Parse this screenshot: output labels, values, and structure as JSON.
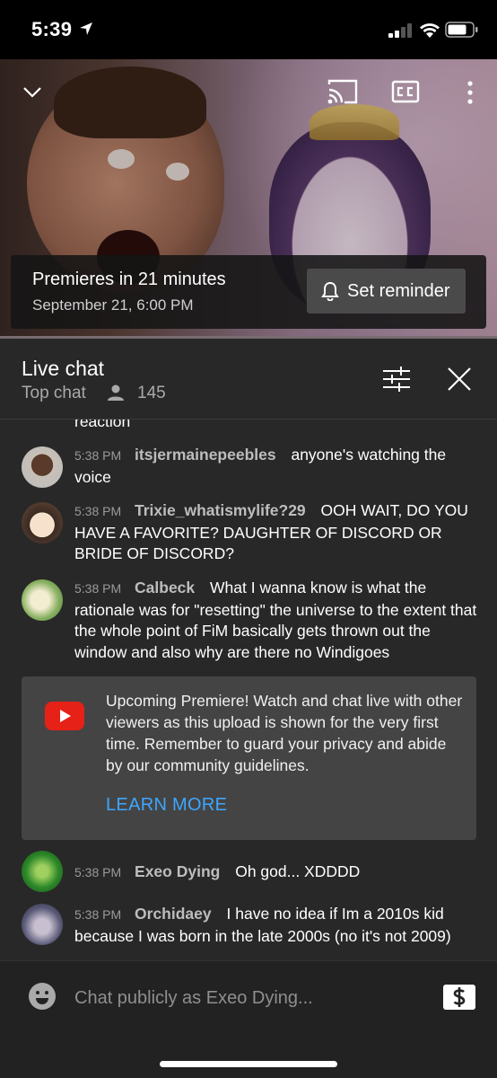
{
  "status_bar": {
    "time": "5:39"
  },
  "video": {
    "premiere_title": "Premieres in 21 minutes",
    "premiere_date": "September 21, 6:00 PM",
    "reminder_label": "Set reminder"
  },
  "chat_header": {
    "title": "Live chat",
    "mode": "Top chat",
    "viewer_count": "145"
  },
  "messages": {
    "cut_text": "reaction",
    "items": [
      {
        "time": "5:38 PM",
        "author": "itsjermainepeebles",
        "text": "anyone's watching the voice",
        "avatar_color": "#6a4e3a"
      },
      {
        "time": "5:38 PM",
        "author": "Trixie_whatismylife?29",
        "text": "OOH WAIT, DO YOU HAVE A FAVORITE? DAUGHTER OF DISCORD OR BRIDE OF DISCORD?",
        "avatar_color": "#f2d8c0"
      },
      {
        "time": "5:38 PM",
        "author": "Calbeck",
        "text": "What I wanna know is what the rationale was for \"resetting\" the universe to the extent that the whole point of FiM basically gets thrown out the window and also why are there no Windigoes",
        "avatar_color": "#7aa85a"
      },
      {
        "time": "5:38 PM",
        "author": "Exeo Dying",
        "text": "Oh god... XDDDD",
        "avatar_color": "#2e8a2a"
      },
      {
        "time": "5:38 PM",
        "author": "Orchidaey",
        "text": "I have no idea if Im a 2010s kid because I was born in the late 2000s (no it's not 2009)",
        "avatar_color": "#5a5a78"
      }
    ],
    "notice": {
      "text": "Upcoming Premiere! Watch and chat live with other viewers as this upload is shown for the very first time. Remember to guard your privacy and abide by our community guidelines.",
      "link_label": "LEARN MORE"
    }
  },
  "input": {
    "placeholder": "Chat publicly as Exeo Dying..."
  },
  "colors": {
    "link": "#3ea6ff",
    "youtube_red": "#e62117",
    "background": "#282828"
  }
}
